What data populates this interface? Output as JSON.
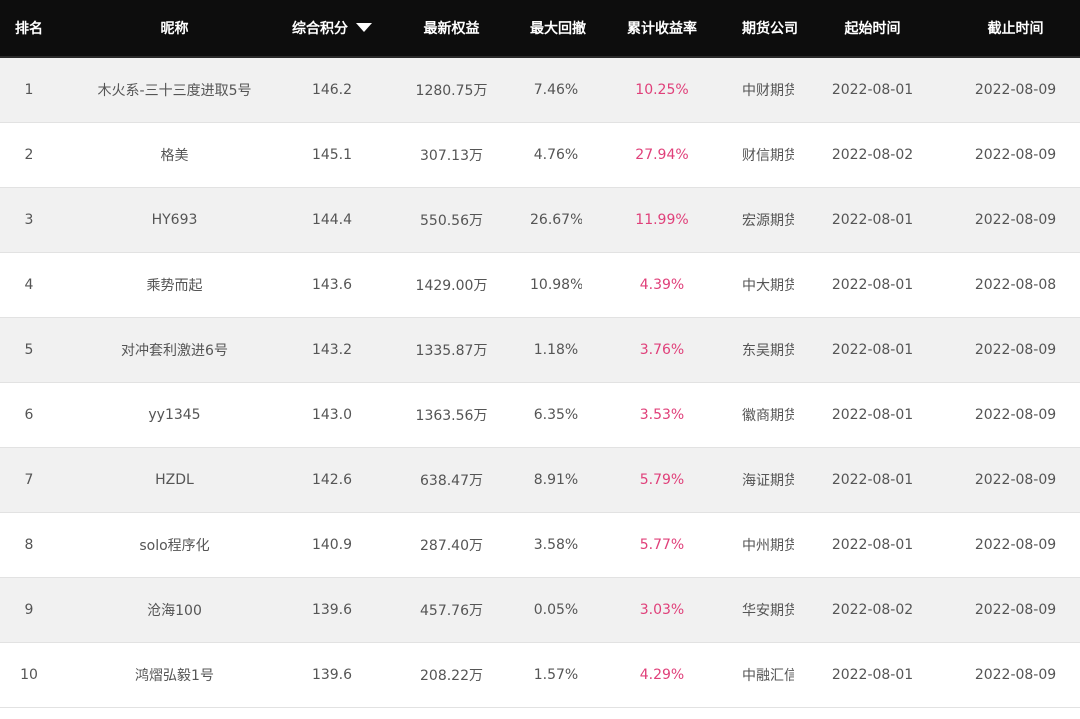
{
  "header": {
    "rank": "排名",
    "nickname": "昵称",
    "score": "综合积分",
    "score_sort_icon": "sort-desc-triangle",
    "equity": "最新权益",
    "drawdown": "最大回撤",
    "return_rate": "累计收益率",
    "company": "期货公司",
    "start": "起始时间",
    "end": "截止时间"
  },
  "colors": {
    "header_bg": "#0d0d0d",
    "header_text": "#ffffff",
    "row_odd": "#f1f1f1",
    "row_even": "#ffffff",
    "text": "#555555",
    "rate": "#e0407a"
  },
  "rows": [
    {
      "rank": "1",
      "name": "木火系-三十三度进取5号",
      "score": "146.2",
      "equity": "1280.75万",
      "drawdown": "7.46%",
      "rate": "10.25%",
      "company": "中财期货",
      "start": "2022-08-01",
      "end": "2022-08-09"
    },
    {
      "rank": "2",
      "name": "格美",
      "score": "145.1",
      "equity": "307.13万",
      "drawdown": "4.76%",
      "rate": "27.94%",
      "company": "财信期货",
      "start": "2022-08-02",
      "end": "2022-08-09"
    },
    {
      "rank": "3",
      "name": "HY693",
      "score": "144.4",
      "equity": "550.56万",
      "drawdown": "26.67%",
      "rate": "11.99%",
      "company": "宏源期货",
      "start": "2022-08-01",
      "end": "2022-08-09"
    },
    {
      "rank": "4",
      "name": "乘势而起",
      "score": "143.6",
      "equity": "1429.00万",
      "drawdown": "10.98%",
      "rate": "4.39%",
      "company": "中大期货",
      "start": "2022-08-01",
      "end": "2022-08-08"
    },
    {
      "rank": "5",
      "name": "对冲套利激进6号",
      "score": "143.2",
      "equity": "1335.87万",
      "drawdown": "1.18%",
      "rate": "3.76%",
      "company": "东吴期货",
      "start": "2022-08-01",
      "end": "2022-08-09"
    },
    {
      "rank": "6",
      "name": "yy1345",
      "score": "143.0",
      "equity": "1363.56万",
      "drawdown": "6.35%",
      "rate": "3.53%",
      "company": "徽商期货",
      "start": "2022-08-01",
      "end": "2022-08-09"
    },
    {
      "rank": "7",
      "name": "HZDL",
      "score": "142.6",
      "equity": "638.47万",
      "drawdown": "8.91%",
      "rate": "5.79%",
      "company": "海证期货",
      "start": "2022-08-01",
      "end": "2022-08-09"
    },
    {
      "rank": "8",
      "name": "solo程序化",
      "score": "140.9",
      "equity": "287.40万",
      "drawdown": "3.58%",
      "rate": "5.77%",
      "company": "中州期货",
      "start": "2022-08-01",
      "end": "2022-08-09"
    },
    {
      "rank": "9",
      "name": "沧海100",
      "score": "139.6",
      "equity": "457.76万",
      "drawdown": "0.05%",
      "rate": "3.03%",
      "company": "华安期货",
      "start": "2022-08-02",
      "end": "2022-08-09"
    },
    {
      "rank": "10",
      "name": "鸿熠弘毅1号",
      "score": "139.6",
      "equity": "208.22万",
      "drawdown": "1.57%",
      "rate": "4.29%",
      "company": "中融汇信",
      "start": "2022-08-01",
      "end": "2022-08-09"
    }
  ]
}
